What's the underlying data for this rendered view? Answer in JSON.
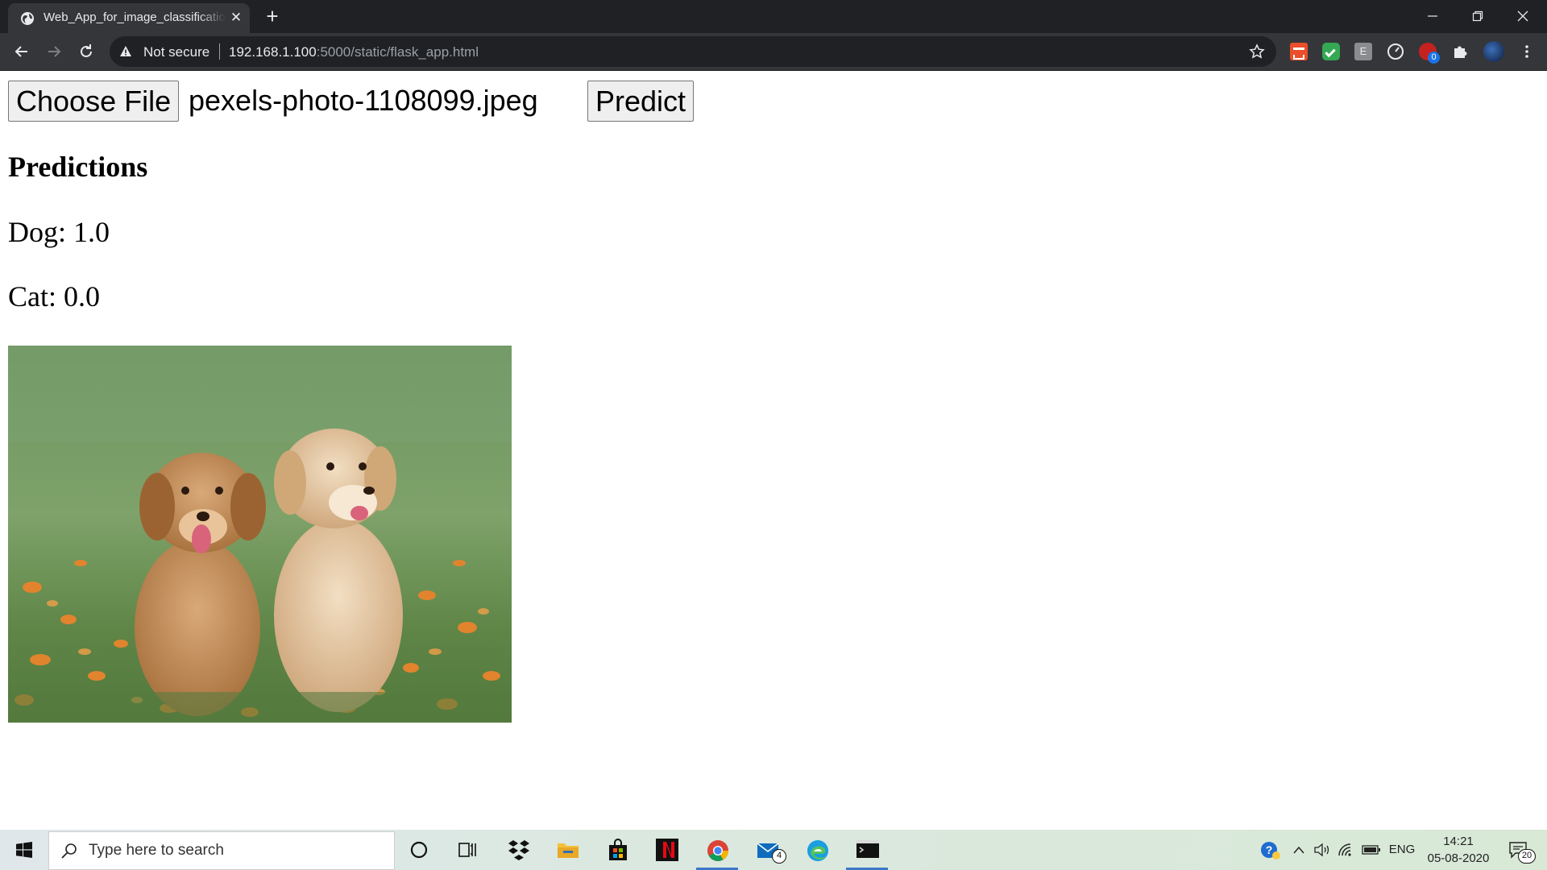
{
  "browser": {
    "tab_title": "Web_App_for_image_classificatio",
    "security_label": "Not secure",
    "url_host": "192.168.1.100",
    "url_path": ":5000/static/flask_app.html",
    "extensions_badge": "0"
  },
  "page": {
    "choose_file_label": "Choose File",
    "file_name": "pexels-photo-1108099.jpeg",
    "predict_label": "Predict",
    "heading": "Predictions",
    "predictions": [
      {
        "text": "Dog: 1.0"
      },
      {
        "text": "Cat: 0.0"
      }
    ]
  },
  "taskbar": {
    "search_placeholder": "Type here to search",
    "mail_badge": "4",
    "language": "ENG",
    "time": "14:21",
    "date": "05-08-2020",
    "notification_count": "20"
  },
  "colors": {
    "chrome_dark": "#202124",
    "chrome_toolbar": "#35363a",
    "taskbar_active": "#3c78c8"
  }
}
